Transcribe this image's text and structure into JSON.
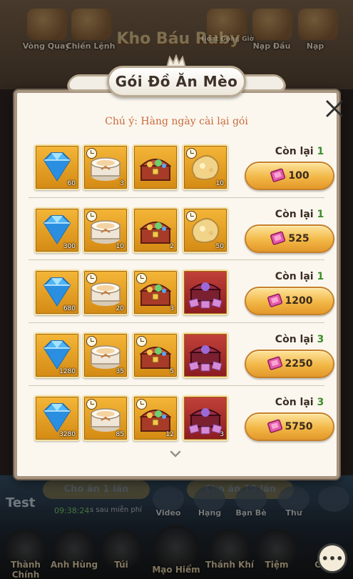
{
  "background": {
    "top_labels": [
      "Vòng Quay",
      "Chiến Lệnh",
      "Hoạt Động Giờ",
      "Nạp Đầu",
      "Nạp"
    ],
    "top_title": "Kho Báu Ruby",
    "feed_buttons": [
      "Cho ăn 1 lần",
      "Cho ăn 10 lần"
    ],
    "test_label": "Test",
    "timer": "09:38:24",
    "free_text": "s sau miễn phí",
    "small_buttons": [
      "Video",
      "Hạng",
      "Bạn Bè",
      "Thư"
    ],
    "nav_labels": [
      "Thành Chính",
      "Anh Hùng",
      "Túi",
      "Mạo Hiểm",
      "Thánh Khí",
      "Tiệm",
      "Gi..."
    ]
  },
  "modal": {
    "title": "Gói Đồ Ăn Mèo",
    "notice": "Chú ý: Hàng ngày cài lại gói",
    "remain_label": "Còn lại",
    "packages": [
      {
        "remaining": "1",
        "price": "100",
        "items": [
          {
            "icon": "diamond-icon",
            "qty": "60",
            "timed": false,
            "bg": "gold"
          },
          {
            "icon": "cat-food-can-icon",
            "qty": "3",
            "timed": true,
            "bg": "gold"
          },
          {
            "icon": "treasure-chest-icon",
            "qty": "",
            "timed": false,
            "bg": "gold"
          },
          {
            "icon": "gold-nugget-icon",
            "qty": "10",
            "timed": true,
            "bg": "gold"
          }
        ]
      },
      {
        "remaining": "1",
        "price": "525",
        "items": [
          {
            "icon": "diamond-icon",
            "qty": "300",
            "timed": false,
            "bg": "gold"
          },
          {
            "icon": "cat-food-can-icon",
            "qty": "10",
            "timed": true,
            "bg": "gold"
          },
          {
            "icon": "treasure-chest-icon",
            "qty": "2",
            "timed": false,
            "bg": "gold"
          },
          {
            "icon": "gold-nugget-icon",
            "qty": "50",
            "timed": true,
            "bg": "gold"
          }
        ]
      },
      {
        "remaining": "1",
        "price": "1200",
        "items": [
          {
            "icon": "diamond-icon",
            "qty": "680",
            "timed": false,
            "bg": "gold"
          },
          {
            "icon": "cat-food-can-icon",
            "qty": "20",
            "timed": true,
            "bg": "gold"
          },
          {
            "icon": "treasure-chest-icon",
            "qty": "3",
            "timed": true,
            "bg": "gold"
          },
          {
            "icon": "ticket-chest-icon",
            "qty": "",
            "timed": false,
            "bg": "red"
          }
        ]
      },
      {
        "remaining": "3",
        "price": "2250",
        "items": [
          {
            "icon": "diamond-icon",
            "qty": "1280",
            "timed": false,
            "bg": "gold"
          },
          {
            "icon": "cat-food-can-icon",
            "qty": "35",
            "timed": true,
            "bg": "gold"
          },
          {
            "icon": "treasure-chest-icon",
            "qty": "5",
            "timed": true,
            "bg": "gold"
          },
          {
            "icon": "ticket-chest-icon",
            "qty": "",
            "timed": false,
            "bg": "red"
          }
        ]
      },
      {
        "remaining": "3",
        "price": "5750",
        "items": [
          {
            "icon": "diamond-icon",
            "qty": "3280",
            "timed": false,
            "bg": "gold"
          },
          {
            "icon": "cat-food-can-icon",
            "qty": "85",
            "timed": true,
            "bg": "gold"
          },
          {
            "icon": "treasure-chest-icon",
            "qty": "12",
            "timed": true,
            "bg": "gold"
          },
          {
            "icon": "ticket-chest-icon",
            "qty": "3",
            "timed": false,
            "bg": "red"
          }
        ]
      }
    ]
  },
  "colors": {
    "notice": "#c86a3a",
    "remaining_number": "#3c8d2a",
    "button_gold": "#f2b746",
    "panel": "#fbf7ef"
  }
}
